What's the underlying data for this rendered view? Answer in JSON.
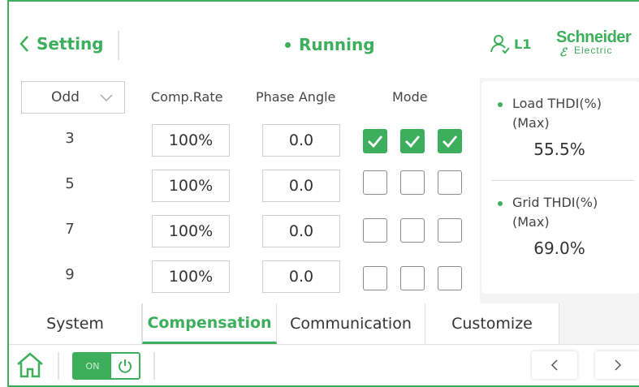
{
  "colors": {
    "accent": "#3dae5b",
    "border": "#cfcfcf",
    "panel_bg": "#f4f4f4"
  },
  "header": {
    "back_label": "Setting",
    "status_label": "Running",
    "user_label": "L1",
    "logo_line1": "Schneider",
    "logo_line2": "Electric"
  },
  "controls": {
    "harmonic_filter": "Odd",
    "col_rate": "Comp.Rate",
    "col_angle": "Phase Angle",
    "col_mode": "Mode"
  },
  "rows": [
    {
      "order": "3",
      "rate": "100%",
      "angle": "0.0",
      "mode": [
        true,
        true,
        true
      ]
    },
    {
      "order": "5",
      "rate": "100%",
      "angle": "0.0",
      "mode": [
        false,
        false,
        false
      ]
    },
    {
      "order": "7",
      "rate": "100%",
      "angle": "0.0",
      "mode": [
        false,
        false,
        false
      ]
    },
    {
      "order": "9",
      "rate": "100%",
      "angle": "0.0",
      "mode": [
        false,
        false,
        false
      ]
    }
  ],
  "panel": {
    "load_title_1": "Load THDI(%)",
    "load_title_2": "(Max)",
    "load_value": "55.5%",
    "grid_title_1": "Grid THDI(%)",
    "grid_title_2": "(Max)",
    "grid_value": "69.0%"
  },
  "tabs": [
    "System",
    "Compensation",
    "Communication",
    "Customize"
  ],
  "active_tab": 1,
  "footer": {
    "power_on_label": "ON",
    "power_state": "on"
  },
  "icons": [
    "chevron-left-icon",
    "user-icon",
    "chevron-down-icon",
    "check-icon",
    "home-icon",
    "power-icon",
    "chevron-right-icon"
  ]
}
